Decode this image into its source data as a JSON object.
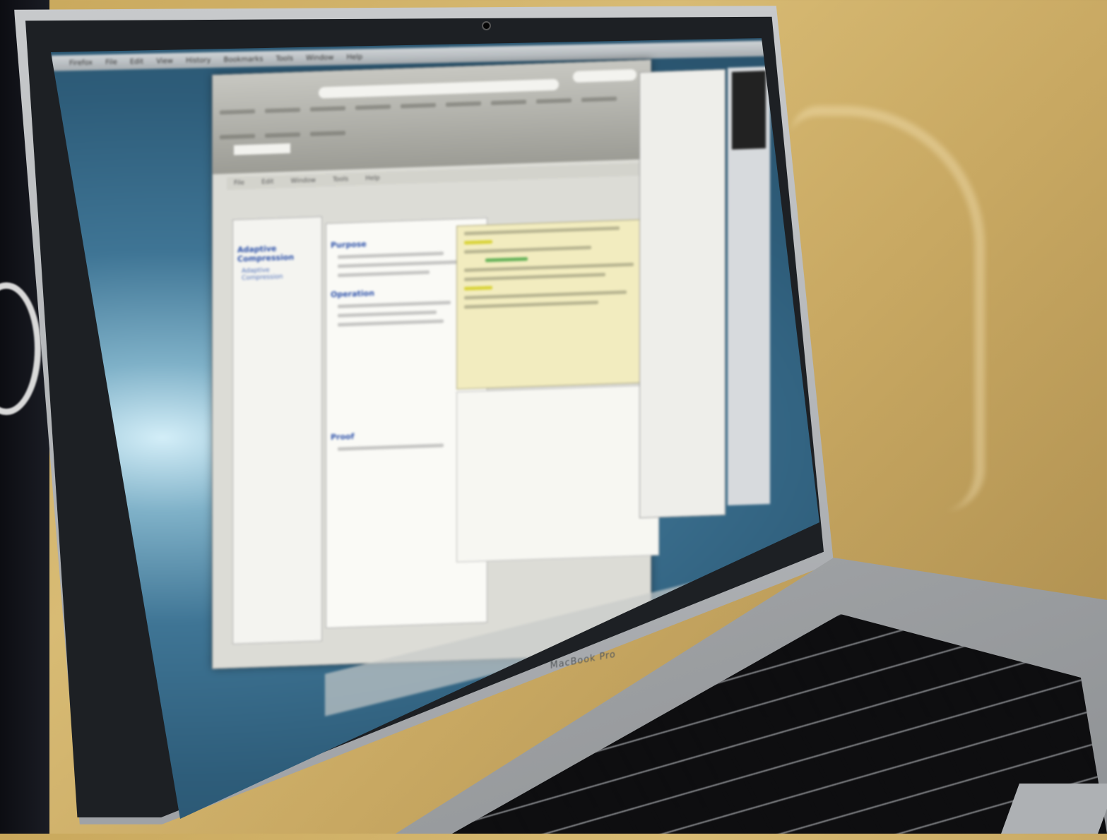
{
  "scene": {
    "description_tags": [
      "laptop",
      "photo",
      "screen"
    ],
    "brand_label": "MacBook Pro"
  },
  "screen": {
    "menubar": [
      "Firefox",
      "File",
      "Edit",
      "View",
      "History",
      "Bookmarks",
      "Tools",
      "Window",
      "Help"
    ],
    "inner_menu": [
      "File",
      "Edit",
      "Window",
      "Tools",
      "Help"
    ],
    "left_pane": {
      "title": "Adaptive Compression",
      "items": [
        "Adaptive Compression"
      ]
    },
    "doc_pane": {
      "headings": [
        "Purpose",
        "Operation",
        "Proof"
      ]
    }
  },
  "colors": {
    "wall": "#c9a85c",
    "screen_bg": "#2e5d7a",
    "code_bg": "#f2ecbf",
    "link": "#2a4fa8"
  }
}
